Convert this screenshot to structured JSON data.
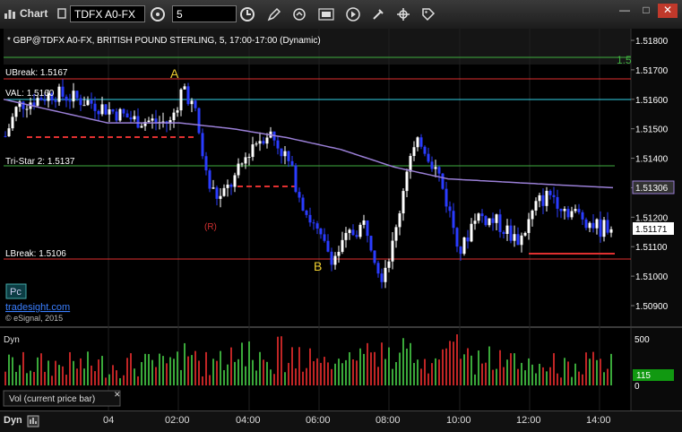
{
  "window": {
    "title": "Chart",
    "symbol": "TDFX A0-FX",
    "interval": "5"
  },
  "header": {
    "description": "* GBP@TDFX A0-FX, BRITISH POUND STERLING, 5, 17:00-17:00 (Dynamic)"
  },
  "price_axis": [
    "1.51800",
    "1.51700",
    "1.51600",
    "1.51500",
    "1.51400",
    "1.51300",
    "1.51200",
    "1.51100",
    "1.51000",
    "1.50900"
  ],
  "price_badges": {
    "ma": "1.51306",
    "last": "1.51171",
    "edge": "1.5"
  },
  "levels": {
    "ubreak": "UBreak: 1.5167",
    "val": "VAL: 1.5160",
    "tristar": "Tri-Star 2: 1.5137",
    "lbreak": "LBreak: 1.5106"
  },
  "annotations": {
    "a": "A",
    "b": "B",
    "r": "(R)"
  },
  "branding": {
    "pc": "Pc",
    "site": "tradesight.com",
    "copyright": "© eSignal, 2015"
  },
  "volume": {
    "label": "Dyn",
    "axis_top": "500",
    "axis_bottom": "0",
    "current": "115",
    "legend": "Vol (current price bar)"
  },
  "time_axis": [
    "04",
    "02:00",
    "04:00",
    "06:00",
    "08:00",
    "10:00",
    "12:00",
    "14:00"
  ],
  "bottom": {
    "dyn": "Dyn"
  },
  "colors": {
    "up": "#ffffff",
    "down": "#2a3cff",
    "ma": "#9a7fd6",
    "ubreak": "#e03030",
    "val": "#35d4e8",
    "tristar": "#3fae3f",
    "lbreak": "#e03030",
    "vol_up": "#3aa83a",
    "vol_down": "#c02525"
  }
}
